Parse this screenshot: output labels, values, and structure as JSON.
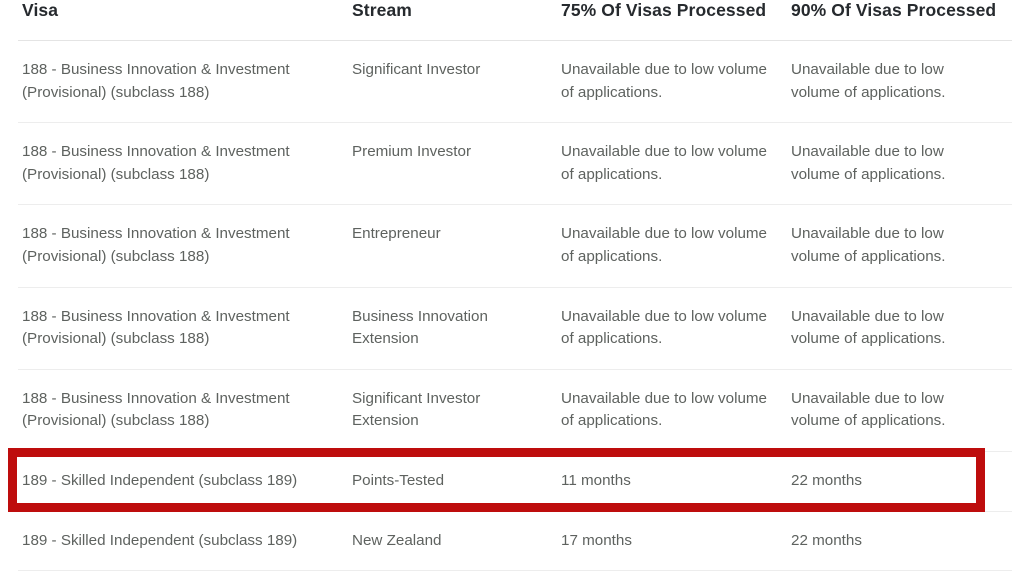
{
  "table": {
    "columns": [
      {
        "key": "visa",
        "label": "Visa"
      },
      {
        "key": "stream",
        "label": "Stream"
      },
      {
        "key": "p75",
        "label": "75% Of Visas Processed"
      },
      {
        "key": "p90",
        "label": "90% Of Visas Processed"
      }
    ],
    "rows": [
      {
        "visa": "188 - Business Innovation & Investment (Provisional) (subclass 188)",
        "stream": "Significant Investor",
        "p75": "Unavailable due to low volume of applications.",
        "p90": "Unavailable due to low volume of applications.",
        "highlighted": false
      },
      {
        "visa": "188 - Business Innovation & Investment (Provisional) (subclass 188)",
        "stream": "Premium Investor",
        "p75": "Unavailable due to low volume of applications.",
        "p90": "Unavailable due to low volume of applications.",
        "highlighted": false
      },
      {
        "visa": "188 - Business Innovation & Investment (Provisional) (subclass 188)",
        "stream": "Entrepreneur",
        "p75": "Unavailable due to low volume of applications.",
        "p90": "Unavailable due to low volume of applications.",
        "highlighted": false
      },
      {
        "visa": "188 - Business Innovation & Investment (Provisional) (subclass 188)",
        "stream": "Business Innovation Extension",
        "p75": "Unavailable due to low volume of applications.",
        "p90": "Unavailable due to low volume of applications.",
        "highlighted": false
      },
      {
        "visa": "188 - Business Innovation & Investment (Provisional) (subclass 188)",
        "stream": "Significant Investor Extension",
        "p75": "Unavailable due to low volume of applications.",
        "p90": "Unavailable due to low volume of applications.",
        "highlighted": false
      },
      {
        "visa": "189 - Skilled Independent (subclass 189)",
        "stream": "Points-Tested",
        "p75": "11 months",
        "p90": "22 months",
        "highlighted": true
      },
      {
        "visa": "189 - Skilled Independent (subclass 189)",
        "stream": "New Zealand",
        "p75": "17 months",
        "p90": "22 months",
        "highlighted": false
      }
    ]
  },
  "annotation": {
    "type": "red-rectangle-highlight",
    "target_row_index": 5,
    "color": "#be0d0d"
  },
  "colors": {
    "header_text": "#262a2e",
    "body_text": "#5e625f",
    "divider": "#ededed",
    "background": "#ffffff",
    "highlight_red": "#be0d0d"
  }
}
